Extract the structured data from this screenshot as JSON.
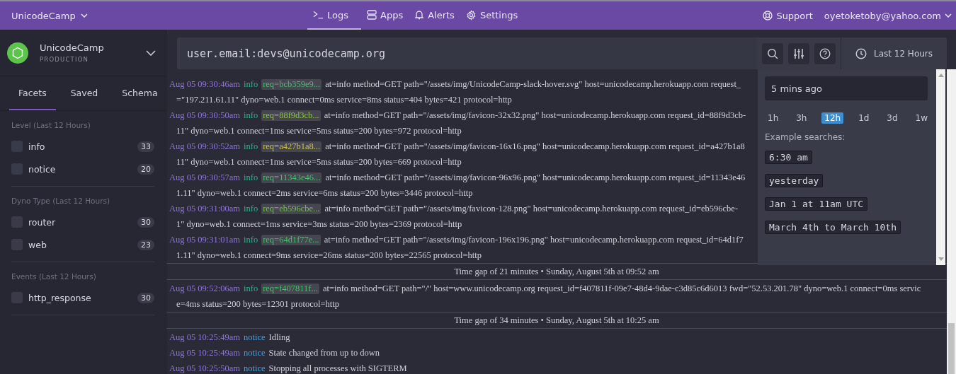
{
  "topbar": {
    "app": "UnicodeCamp",
    "nav": [
      {
        "label": "Logs",
        "selected": true
      },
      {
        "label": "Apps",
        "selected": false
      },
      {
        "label": "Alerts",
        "selected": false
      },
      {
        "label": "Settings",
        "selected": false
      }
    ],
    "support": "Support",
    "user": "oyetoketoby@yahoo.com"
  },
  "sidebar": {
    "app_name": "UnicodeCamp",
    "environment": "PRODUCTION",
    "tabs": [
      {
        "label": "Facets",
        "selected": true
      },
      {
        "label": "Saved",
        "selected": false
      },
      {
        "label": "Schema",
        "selected": false
      }
    ],
    "groups": [
      {
        "title": "Level (Last 12 Hours)",
        "items": [
          {
            "label": "info",
            "count": "33",
            "checked": false
          },
          {
            "label": "notice",
            "count": "20",
            "checked": false
          }
        ]
      },
      {
        "title": "Dyno Type (Last 12 Hours)",
        "items": [
          {
            "label": "router",
            "count": "30",
            "checked": false
          },
          {
            "label": "web",
            "count": "23",
            "checked": false
          }
        ]
      },
      {
        "title": "Events (Last 12 Hours)",
        "items": [
          {
            "label": "http_response",
            "count": "30",
            "checked": false
          }
        ]
      }
    ]
  },
  "search": {
    "value": "user.email:devs@unicodecamp.org",
    "time_range": "Last 12 Hours"
  },
  "time_popover": {
    "value": "5 mins ago",
    "ranges": [
      {
        "label": "1h",
        "selected": false
      },
      {
        "label": "3h",
        "selected": false
      },
      {
        "label": "12h",
        "selected": true
      },
      {
        "label": "1d",
        "selected": false
      },
      {
        "label": "3d",
        "selected": false
      },
      {
        "label": "1w",
        "selected": false
      }
    ],
    "examples_title": "Example searches:",
    "examples": [
      "6:30 am",
      "yesterday",
      "Jan 1 at 11am UTC",
      "March 4th to March 10th"
    ]
  },
  "logs": [
    {
      "kind": "entry",
      "time": "Aug 05 09:30:46am",
      "level": "info",
      "color": "#1fb98a",
      "req": {
        "text": "req=bcb359e9...",
        "color": "#3fc46a"
      },
      "lines": [
        "at=info method=GET path=\"/assets/img/UnicodeCamp-slack-hover.svg\" host=unicodecamp.herokuapp.com request_",
        "=\"197.211.61.11\" dyno=web.1 connect=0ms service=8ms status=404 bytes=421 protocol=http"
      ]
    },
    {
      "kind": "entry",
      "time": "Aug 05 09:30:50am",
      "level": "info",
      "color": "#1fb98a",
      "req": {
        "text": "req=88f9d3cb...",
        "color": "#8dc43f"
      },
      "lines": [
        "at=info method=GET path=\"/assets/img/favicon-32x32.png\" host=unicodecamp.herokuapp.com request_id=88f9d3cb-",
        "11\" dyno=web.1 connect=1ms service=5ms status=200 bytes=972 protocol=http"
      ]
    },
    {
      "kind": "entry",
      "time": "Aug 05 09:30:52am",
      "level": "info",
      "color": "#1fb98a",
      "req": {
        "text": "req=a427b1a8...",
        "color": "#c9c04a"
      },
      "lines": [
        "at=info method=GET path=\"/assets/img/favicon-16x16.png\" host=unicodecamp.herokuapp.com request_id=a427b1a8",
        "11\" dyno=web.1 connect=1ms service=5ms status=200 bytes=669 protocol=http"
      ]
    },
    {
      "kind": "entry",
      "time": "Aug 05 09:30:57am",
      "level": "info",
      "color": "#1fb98a",
      "req": {
        "text": "req=11343e46...",
        "color": "#3fc46a"
      },
      "lines": [
        "at=info method=GET path=\"/assets/img/favicon-96x96.png\" host=unicodecamp.herokuapp.com request_id=11343e46",
        "1.11\" dyno=web.1 connect=2ms service=6ms status=200 bytes=3446 protocol=http"
      ]
    },
    {
      "kind": "entry",
      "time": "Aug 05 09:31:00am",
      "level": "info",
      "color": "#1fb98a",
      "req": {
        "text": "req=eb596cbe...",
        "color": "#6cc43f"
      },
      "lines": [
        "at=info method=GET path=\"/assets/img/favicon-128.png\" host=unicodecamp.herokuapp.com request_id=eb596cbe-",
        "1\" dyno=web.1 connect=1ms service=3ms status=200 bytes=2369 protocol=http"
      ]
    },
    {
      "kind": "entry",
      "time": "Aug 05 09:31:01am",
      "level": "info",
      "color": "#1fb98a",
      "req": {
        "text": "req=64d1f77e...",
        "color": "#3fc46a"
      },
      "lines": [
        "at=info method=GET path=\"/assets/img/favicon-196x196.png\" host=unicodecamp.herokuapp.com request_id=64d1f7",
        "1.11\" dyno=web.1 connect=9ms service=26ms status=200 bytes=22565 protocol=http"
      ]
    },
    {
      "kind": "gap",
      "text": "Time gap of 21 minutes • Sunday, August 5th at 09:52 am"
    },
    {
      "kind": "entry",
      "time": "Aug 05 09:52:06am",
      "level": "info",
      "color": "#1fb98a",
      "req": {
        "text": "req=f407811f...",
        "color": "#3fc46a"
      },
      "lines": [
        "at=info method=GET path=\"/\" host=www.unicodecamp.org request_id=f407811f-09e7-48d4-9dae-c3d85c6d6013 fwd=\"52.53.201.78\" dyno=web.1 connect=0ms servic",
        "e=4ms status=200 bytes=12301 protocol=http"
      ]
    },
    {
      "kind": "gap",
      "text": "Time gap of 34 minutes • Sunday, August 5th at 10:25 am"
    },
    {
      "kind": "entry",
      "time": "Aug 05 10:25:49am",
      "level": "notice",
      "color": "#3ea3e0",
      "lines": [
        "Idling"
      ]
    },
    {
      "kind": "entry",
      "time": "Aug 05 10:25:49am",
      "level": "notice",
      "color": "#3ea3e0",
      "lines": [
        "State changed from up to down"
      ]
    },
    {
      "kind": "entry",
      "time": "Aug 05 10:25:50am",
      "level": "notice",
      "color": "#3ea3e0",
      "lines": [
        "Stopping all processes with SIGTERM"
      ]
    }
  ]
}
